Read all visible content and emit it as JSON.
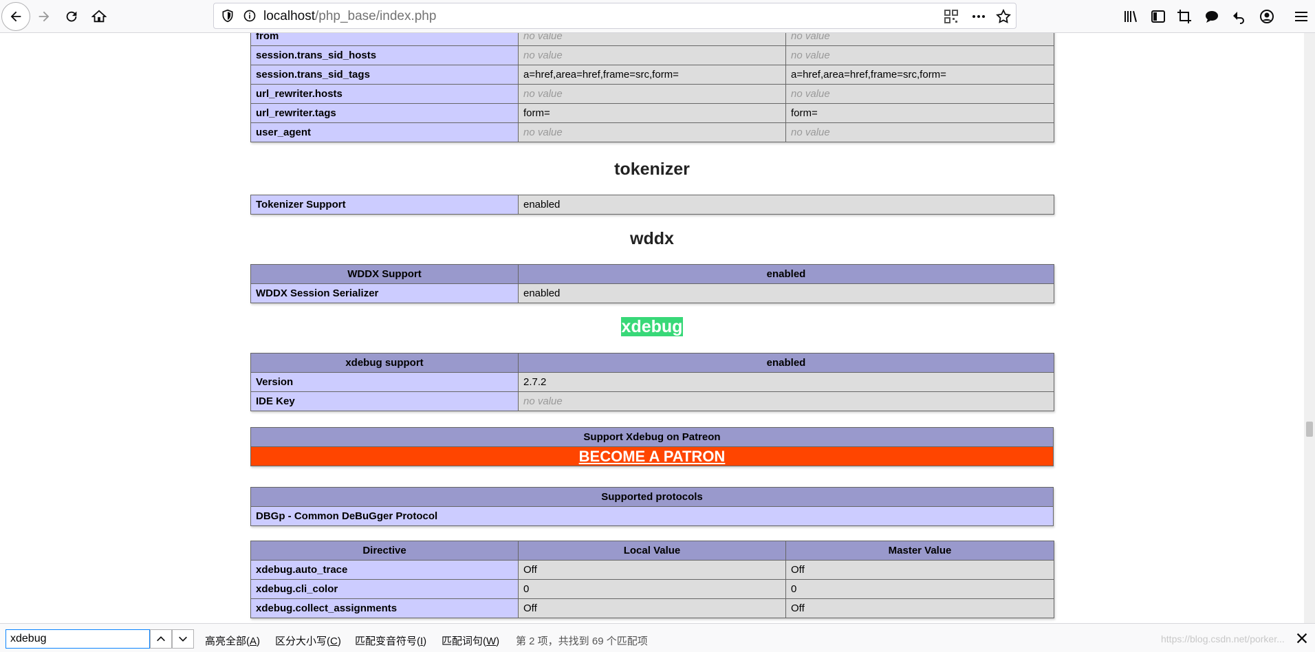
{
  "browser": {
    "url_host": "localhost",
    "url_path": "/php_base/index.php"
  },
  "session_rows": [
    {
      "name": "from",
      "local": "no value",
      "master": "no value",
      "nv": true
    },
    {
      "name": "session.trans_sid_hosts",
      "local": "no value",
      "master": "no value",
      "nv": true
    },
    {
      "name": "session.trans_sid_tags",
      "local": "a=href,area=href,frame=src,form=",
      "master": "a=href,area=href,frame=src,form=",
      "nv": false
    },
    {
      "name": "url_rewriter.hosts",
      "local": "no value",
      "master": "no value",
      "nv": true
    },
    {
      "name": "url_rewriter.tags",
      "local": "form=",
      "master": "form=",
      "nv": false
    },
    {
      "name": "user_agent",
      "local": "no value",
      "master": "no value",
      "nv": true
    }
  ],
  "tokenizer": {
    "title": "tokenizer",
    "row_name": "Tokenizer Support",
    "row_value": "enabled"
  },
  "wddx": {
    "title": "wddx",
    "header_left": "WDDX Support",
    "header_right": "enabled",
    "row_name": "WDDX Session Serializer",
    "row_value": "enabled"
  },
  "xdebug": {
    "title": "xdebug",
    "header_left": "xdebug support",
    "header_right": "enabled",
    "version_label": "Version",
    "version_value": "2.7.2",
    "idekey_label": "IDE Key",
    "idekey_value": "no value",
    "patreon_header": "Support Xdebug on Patreon",
    "patreon_link": "BECOME A PATRON",
    "protocols_header": "Supported protocols",
    "protocol": "DBGp - Common DeBuGger Protocol",
    "dir_headers": [
      "Directive",
      "Local Value",
      "Master Value"
    ],
    "directives": [
      {
        "name": "xdebug.auto_trace",
        "local": "Off",
        "master": "Off"
      },
      {
        "name": "xdebug.cli_color",
        "local": "0",
        "master": "0"
      },
      {
        "name": "xdebug.collect_assignments",
        "local": "Off",
        "master": "Off"
      }
    ]
  },
  "findbar": {
    "query": "xdebug",
    "highlight_all": "高亮全部(",
    "highlight_all_key": "A",
    "match_case": "区分大小写(",
    "match_case_key": "C",
    "match_diacritics": "匹配变音符号(",
    "match_diacritics_key": "I",
    "whole_words": "匹配词句(",
    "whole_words_key": "W",
    "status": "第 2 项，共找到 69 个匹配项",
    "watermark": "https://blog.csdn.net/porker..."
  },
  "colors": {
    "header_bg": "#9999cc",
    "label_bg": "#ccccff",
    "value_bg": "#dddddd",
    "patron_bg": "#ff4500",
    "find_highlight": "#38d878"
  }
}
